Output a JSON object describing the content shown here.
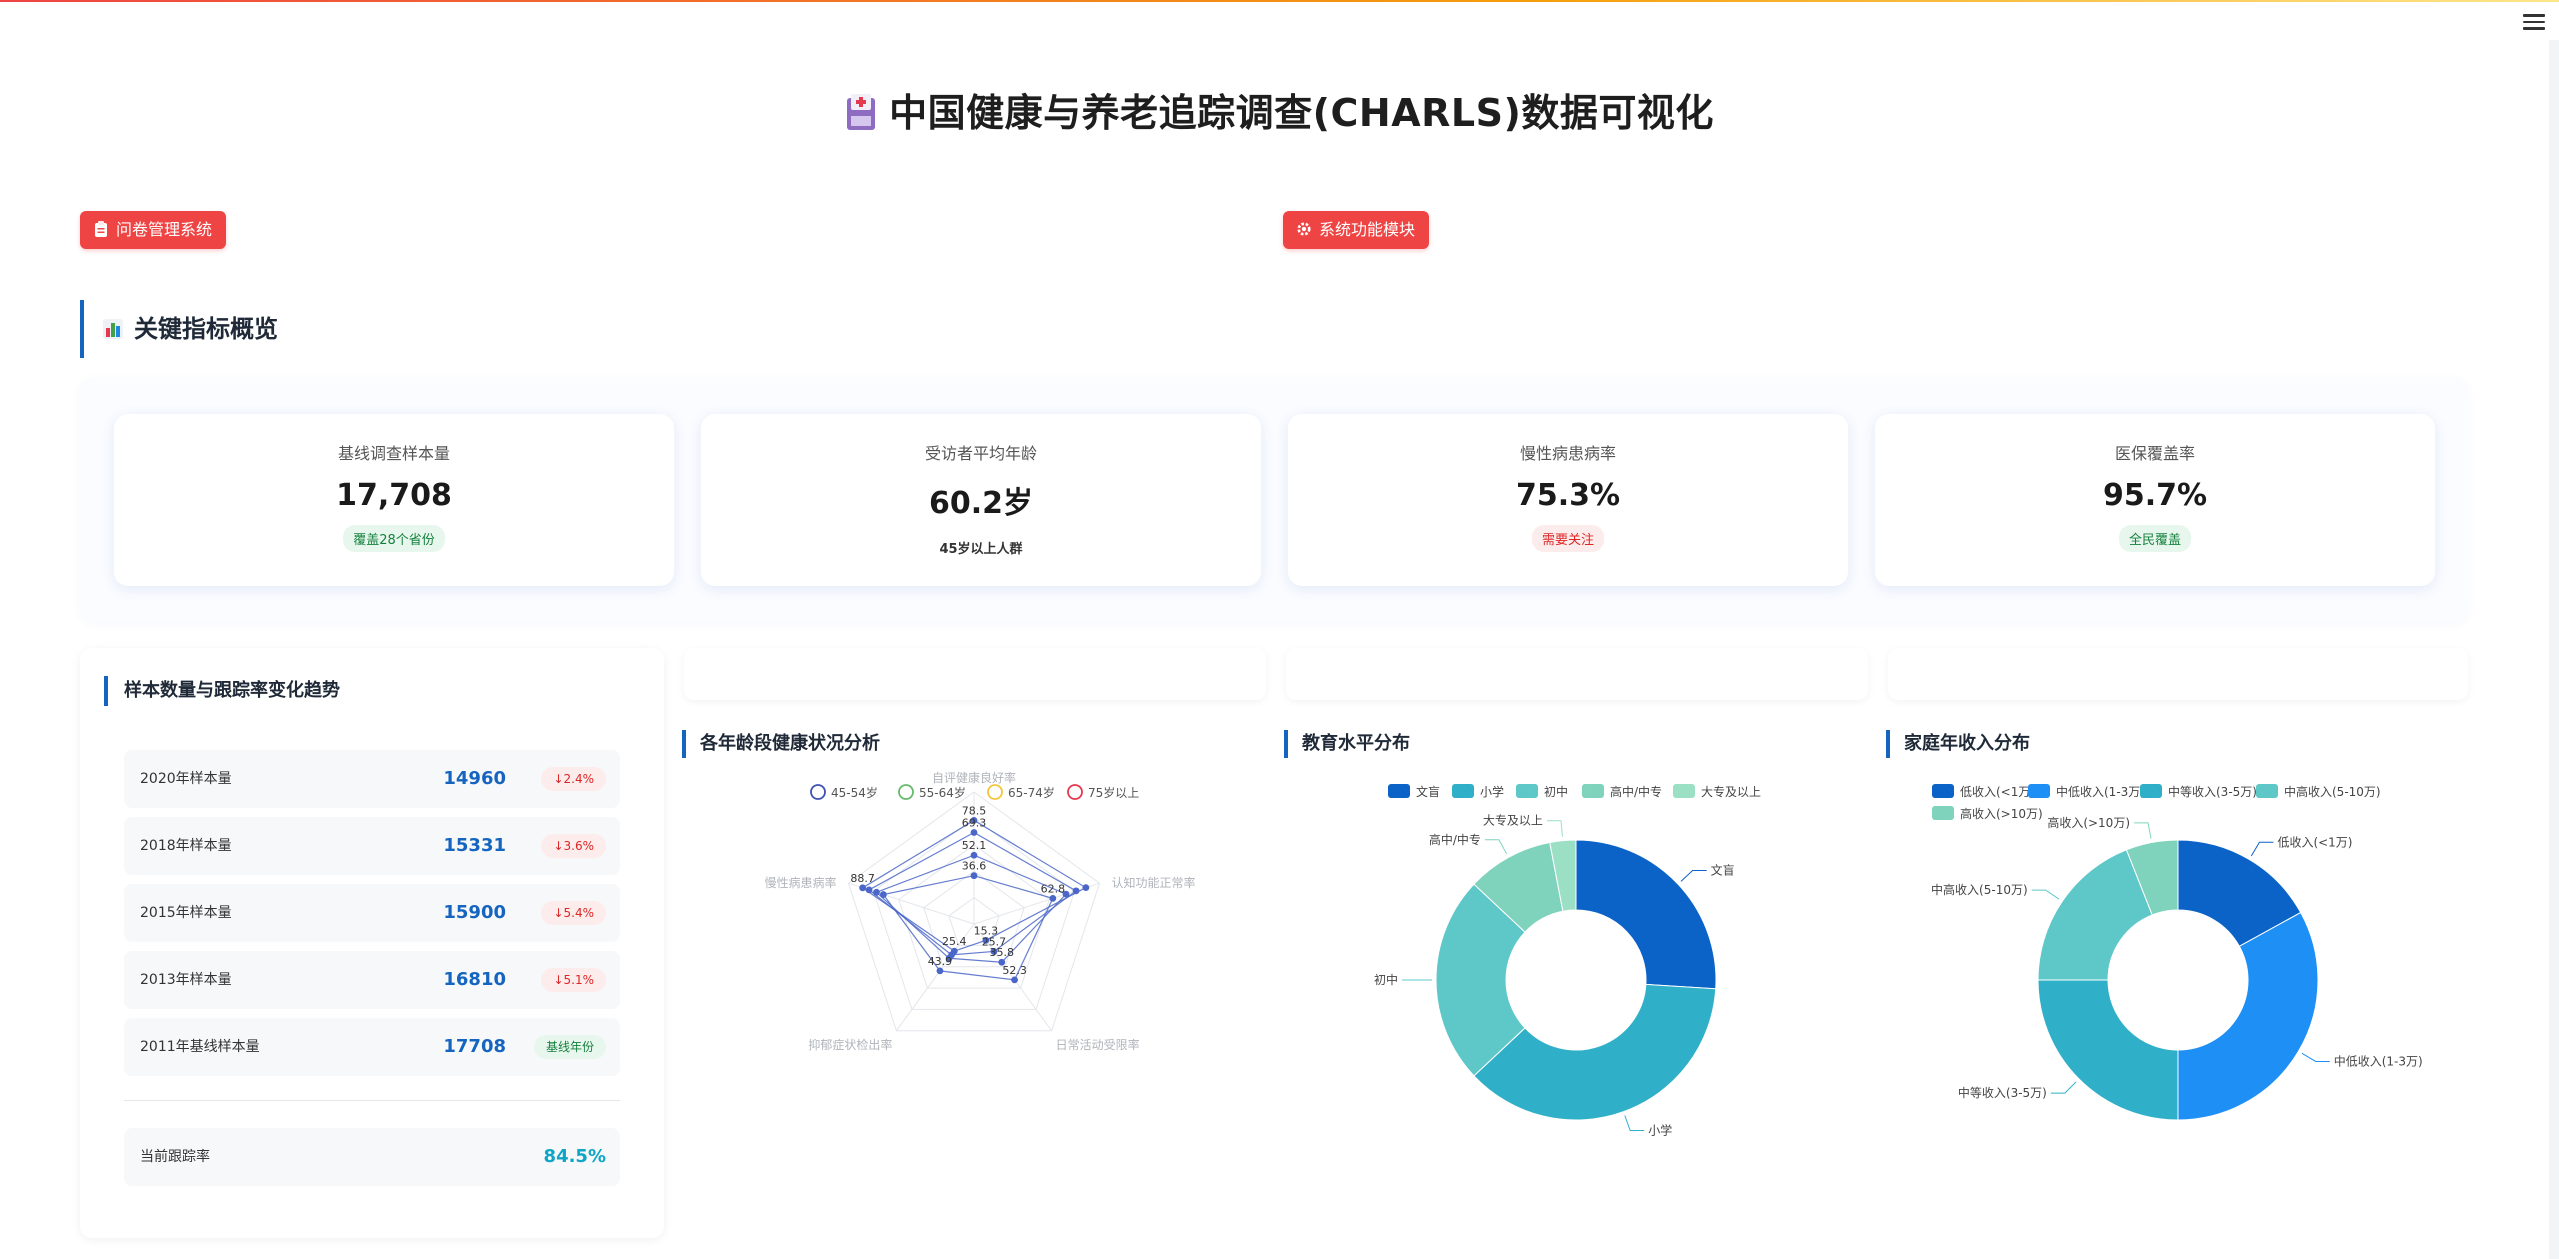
{
  "page": {
    "title": "中国健康与养老追踪调查(CHARLS)数据可视化"
  },
  "buttons": {
    "questionnaire": "问卷管理系统",
    "modules": "系统功能模块"
  },
  "overview": {
    "heading": "关键指标概览",
    "cards": [
      {
        "label": "基线调查样本量",
        "value": "17,708",
        "badge": "覆盖28个省份",
        "badge_type": "green"
      },
      {
        "label": "受访者平均年龄",
        "value": "60.2岁",
        "badge": "45岁以上人群",
        "badge_type": "plain"
      },
      {
        "label": "慢性病患病率",
        "value": "75.3%",
        "badge": "需要关注",
        "badge_type": "red"
      },
      {
        "label": "医保覆盖率",
        "value": "95.7%",
        "badge": "全民覆盖",
        "badge_type": "green"
      }
    ]
  },
  "trend_panel": {
    "title": "样本数量与跟踪率变化趋势",
    "rows": [
      {
        "label": "2020年样本量",
        "value": "14960",
        "change": "↓2.4%",
        "type": "red"
      },
      {
        "label": "2018年样本量",
        "value": "15331",
        "change": "↓3.6%",
        "type": "red"
      },
      {
        "label": "2015年样本量",
        "value": "15900",
        "change": "↓5.4%",
        "type": "red"
      },
      {
        "label": "2013年样本量",
        "value": "16810",
        "change": "↓5.1%",
        "type": "red"
      },
      {
        "label": "2011年基线样本量",
        "value": "17708",
        "change": "基线年份",
        "type": "green"
      }
    ],
    "tracking": {
      "label": "当前跟踪率",
      "value": "84.5%"
    }
  },
  "colors": {
    "accent_blue": "#1565c0",
    "brand_red": "#ef4444",
    "radar_series": [
      "#3f51b5",
      "#66bb6a",
      "#f5c542",
      "#e53950"
    ],
    "education": [
      "#0b63c8",
      "#2fb0c8",
      "#5ec8c8",
      "#7fd3bd",
      "#9be0c4"
    ],
    "income": [
      "#0b63c8",
      "#1e8ff5",
      "#2fb0c8",
      "#5ec8c8",
      "#7fd3bd"
    ]
  },
  "chart_data": [
    {
      "type": "radar",
      "title": "各年龄段健康状况分析",
      "indicators": [
        "自评健康良好率",
        "认知功能正常率",
        "日常活动受限率",
        "抑郁症状检出率",
        "慢性病患病率"
      ],
      "max": 100,
      "series": [
        {
          "name": "45-54岁",
          "values": [
            78.5,
            89.1,
            15.3,
            25.4,
            88.7
          ]
        },
        {
          "name": "55-64岁",
          "values": [
            69.3,
            81.3,
            25.7,
            28.9,
            83.6
          ]
        },
        {
          "name": "65-74岁",
          "values": [
            52.1,
            73.3,
            35.8,
            32.1,
            77.7
          ]
        },
        {
          "name": "75岁以上",
          "values": [
            36.6,
            62.8,
            52.3,
            43.9,
            72.2
          ]
        }
      ],
      "point_labels": [
        "78.5",
        "69.3",
        "52.1",
        "36.6",
        "62.8",
        "15.3",
        "25.7",
        "35.8",
        "52.3",
        "25.4",
        "43.9",
        "88.7"
      ]
    },
    {
      "type": "pie",
      "title": "教育水平分布",
      "categories": [
        "文盲",
        "小学",
        "初中",
        "高中/中专",
        "大专及以上"
      ],
      "values": [
        26,
        37,
        24,
        10,
        3
      ]
    },
    {
      "type": "pie",
      "title": "家庭年收入分布",
      "categories": [
        "低收入(<1万)",
        "中低收入(1-3万)",
        "中等收入(3-5万)",
        "中高收入(5-10万)",
        "高收入(>10万)"
      ],
      "values": [
        17,
        33,
        25,
        19,
        6
      ]
    }
  ]
}
